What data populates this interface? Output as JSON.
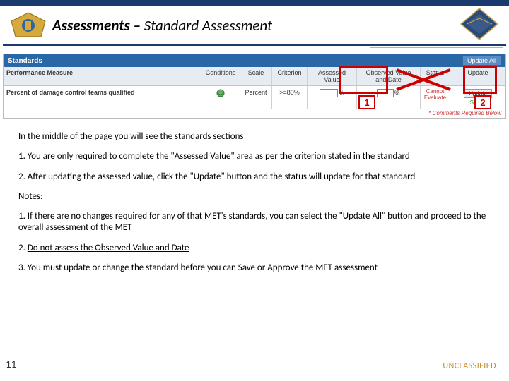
{
  "header": {
    "title_bold": "Assessments – ",
    "title_rest": "Standard Assessment"
  },
  "screenshot": {
    "standards_label": "Standards",
    "update_all": "Update All",
    "cols": {
      "pm": "Performance Measure",
      "cond": "Conditions",
      "scale": "Scale",
      "crit": "Criterion",
      "av": "Assessed Value",
      "ovd": "Observed Value and Date",
      "status": "Status",
      "upd": "Update"
    },
    "row": {
      "pm": "Percent of damage control teams qualified",
      "scale": "Percent",
      "crit": ">=80%",
      "av_value": "",
      "av_suffix": "%",
      "ov_value": "",
      "ov_suffix": "%",
      "status_line1": "Cannot",
      "status_line2": "Evaluate",
      "saved": "Saved",
      "update_btn": "Update"
    },
    "footer_note": "* Comments Required Below"
  },
  "callouts": {
    "one": "1",
    "two": "2"
  },
  "body": {
    "intro": "In the middle of the page you will see the standards sections",
    "p1": "1. You are only required to complete the  \"Assessed Value\" area as per the criterion stated in the standard",
    "p2": "2. After updating the assessed value, click the \"Update\" button and the status will update for that standard",
    "notes_label": "Notes:",
    "n1": "1. If there are no changes required for any of that MET's standards, you can select the \"Update All\" button and proceed to the overall assessment of the MET",
    "n2_prefix": "2. ",
    "n2_underline": "Do not assess the Observed Value and Date",
    "n3": "3. You must update or change the standard before you can Save or Approve the MET assessment"
  },
  "footer": {
    "page": "11",
    "classification": "UNCLASSIFIED"
  }
}
